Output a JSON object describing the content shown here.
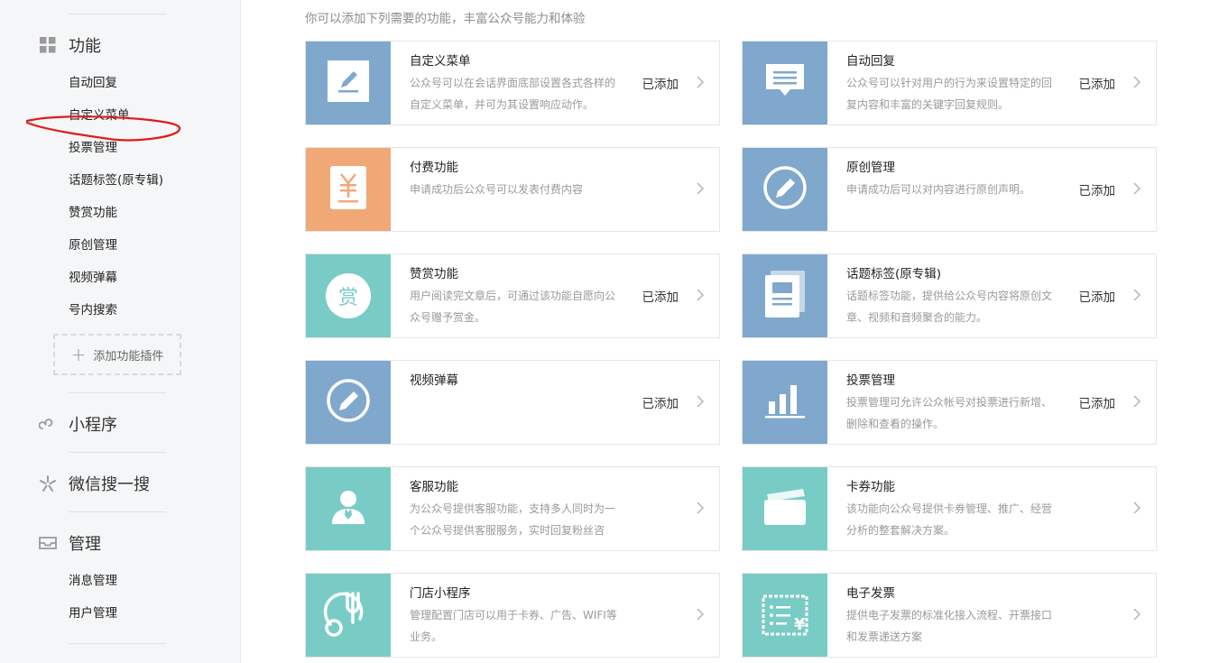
{
  "sidebar": {
    "sections": {
      "function": {
        "title": "功能",
        "icon": "grid-icon"
      },
      "miniprogram": {
        "title": "小程序",
        "icon": "miniprogram-icon"
      },
      "search": {
        "title": "微信搜一搜",
        "icon": "search-spark-icon"
      },
      "manage": {
        "title": "管理",
        "icon": "inbox-icon"
      }
    },
    "function_items": [
      "自动回复",
      "自定义菜单",
      "投票管理",
      "话题标签(原专辑)",
      "赞赏功能",
      "原创管理",
      "视频弹幕",
      "号内搜索"
    ],
    "add_plugin": {
      "plus": "+",
      "label": "添加功能插件"
    },
    "manage_items": [
      "消息管理",
      "用户管理"
    ]
  },
  "main": {
    "intro": "你可以添加下列需要的功能，丰富公众号能力和体验",
    "cards": [
      {
        "title": "自定义菜单",
        "desc": "公众号可以在会话界面底部设置各式各样的自定义菜单，并可为其设置响应动作。",
        "status": "已添加",
        "icon": "edit-pen-icon",
        "color": "#7fa8cc"
      },
      {
        "title": "自动回复",
        "desc": "公众号可以针对用户的行为来设置特定的回复内容和丰富的关键字回复规则。",
        "status": "已添加",
        "icon": "message-icon",
        "color": "#7fa8cc"
      },
      {
        "title": "付费功能",
        "desc": "申请成功后公众号可以发表付费内容",
        "status": "",
        "icon": "yuan-receipt-icon",
        "color": "#f1a877"
      },
      {
        "title": "原创管理",
        "desc": "申请成功后可以对内容进行原创声明。",
        "status": "已添加",
        "icon": "original-pen-icon",
        "color": "#7fa8cc"
      },
      {
        "title": "赞赏功能",
        "desc": "用户阅读完文章后，可通过该功能自愿向公众号赠予赏金。",
        "status": "已添加",
        "icon": "reward-icon",
        "icon_text": "赏",
        "color": "#79ccc6"
      },
      {
        "title": "话题标签(原专辑)",
        "desc": "话题标签功能，提供给公众号内容将原创文章、视频和音频聚合的能力。",
        "status": "已添加",
        "icon": "album-icon",
        "color": "#7fa8cc"
      },
      {
        "title": "视频弹幕",
        "desc": "",
        "status": "已添加",
        "icon": "danmaku-pen-icon",
        "color": "#7fa8cc"
      },
      {
        "title": "投票管理",
        "desc": "投票管理可允许公众帐号对投票进行新增、删除和查看的操作。",
        "status": "已添加",
        "icon": "bar-chart-icon",
        "color": "#7fa8cc"
      },
      {
        "title": "客服功能",
        "desc": "为公众号提供客服功能，支持多人同时为一个公众号提供客服服务，实时回复粉丝咨",
        "status": "",
        "icon": "customer-service-icon",
        "color": "#79ccc6"
      },
      {
        "title": "卡券功能",
        "desc": "该功能向公众号提供卡券管理、推广、经营分析的整套解决方案。",
        "status": "",
        "icon": "card-icon",
        "color": "#79ccc6"
      },
      {
        "title": "门店小程序",
        "desc": "管理配置门店可以用于卡券、广告、WIFI等业务。",
        "status": "",
        "icon": "store-fork-icon",
        "color": "#79ccc6"
      },
      {
        "title": "电子发票",
        "desc": "提供电子发票的标准化接入流程、开票接口和发票递送方案",
        "status": "",
        "icon": "invoice-icon",
        "icon_text": "¥",
        "color": "#79ccc6"
      }
    ]
  }
}
